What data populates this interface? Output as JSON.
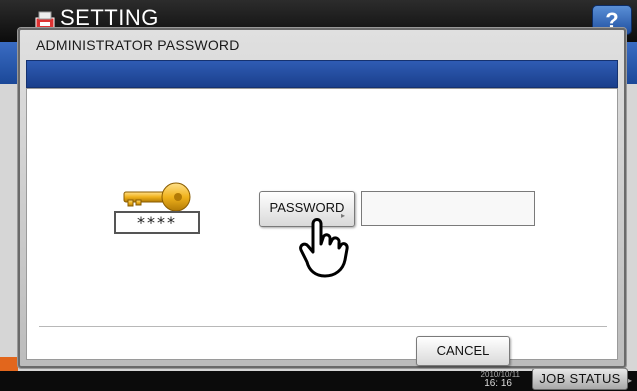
{
  "app": {
    "title": "SETTING",
    "help_label": "?",
    "clock_date": "2010/10/11",
    "clock_time": "16: 16",
    "job_status_label": "JOB STATUS"
  },
  "dialog": {
    "title": "ADMINISTRATOR PASSWORD",
    "masked_text": "****",
    "password_button_label": "PASSWORD",
    "password_value": "",
    "cancel_label": "CANCEL"
  },
  "icons": [
    "printer-icon",
    "key-icon",
    "hand-cursor-icon",
    "small-arrow-icon"
  ],
  "colors": {
    "accent_blue": "#2f5cb4",
    "key_gold": "#f0b21c",
    "orange": "#e2661c"
  }
}
